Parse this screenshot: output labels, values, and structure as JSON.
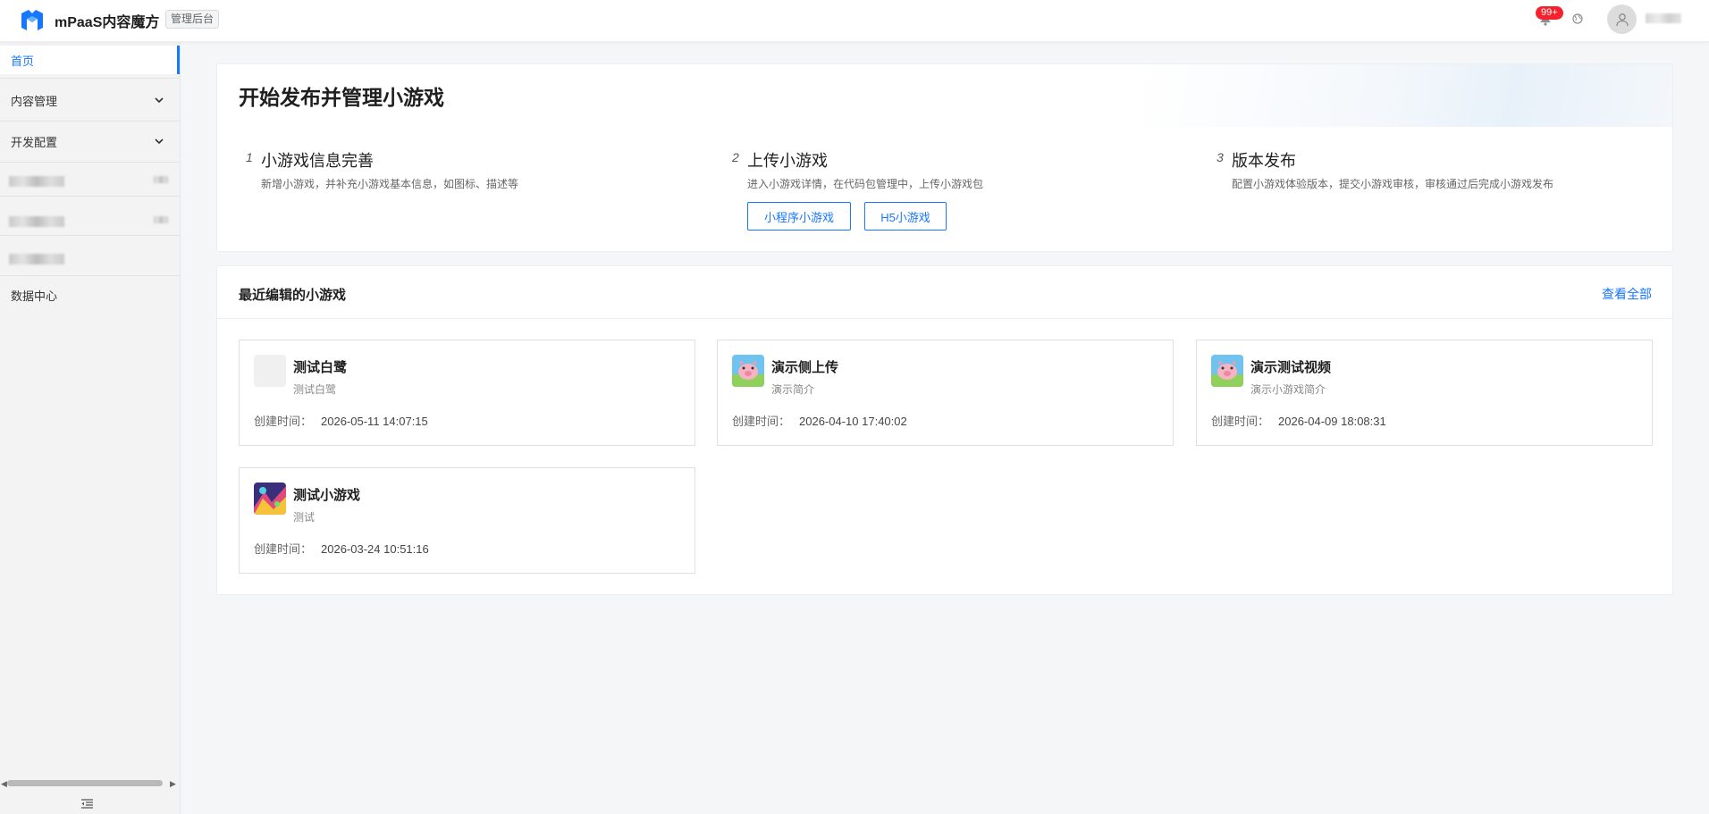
{
  "header": {
    "app_title": "mPaaS内容魔方",
    "admin_tag": "管理后台",
    "notification_badge": "99+"
  },
  "sidebar": {
    "home": "首页",
    "content_mgmt": "内容管理",
    "dev_config": "开发配置",
    "data_center": "数据中心"
  },
  "start": {
    "title": "开始发布并管理小游戏",
    "steps": [
      {
        "num": "1",
        "title": "小游戏信息完善",
        "desc": "新增小游戏，并补充小游戏基本信息，如图标、描述等"
      },
      {
        "num": "2",
        "title": "上传小游戏",
        "desc": "进入小游戏详情，在代码包管理中，上传小游戏包"
      },
      {
        "num": "3",
        "title": "版本发布",
        "desc": "配置小游戏体验版本，提交小游戏审核，审核通过后完成小游戏发布"
      }
    ],
    "btn_miniapp": "小程序小游戏",
    "btn_h5": "H5小游戏"
  },
  "recent": {
    "title": "最近编辑的小游戏",
    "view_all": "查看全部",
    "time_label": "创建时间：",
    "games": [
      {
        "name": "测试白鹭",
        "desc": "测试白鹭",
        "time": "2026-05-11 14:07:15",
        "icon": "blank-icon"
      },
      {
        "name": "演示侧上传",
        "desc": "演示简介",
        "time": "2026-04-10 17:40:02",
        "icon": "pig-game-icon"
      },
      {
        "name": "演示测试视频",
        "desc": "演示小游戏简介",
        "time": "2026-04-09 18:08:31",
        "icon": "pig-game-icon"
      },
      {
        "name": "测试小游戏",
        "desc": "测试",
        "time": "2026-03-24 10:51:16",
        "icon": "colorful-game-icon"
      }
    ]
  },
  "colors": {
    "primary": "#1677ff",
    "badge": "#f5222d",
    "sidebar_bg": "#f3f3f4",
    "page_bg": "#f5f6f7"
  }
}
